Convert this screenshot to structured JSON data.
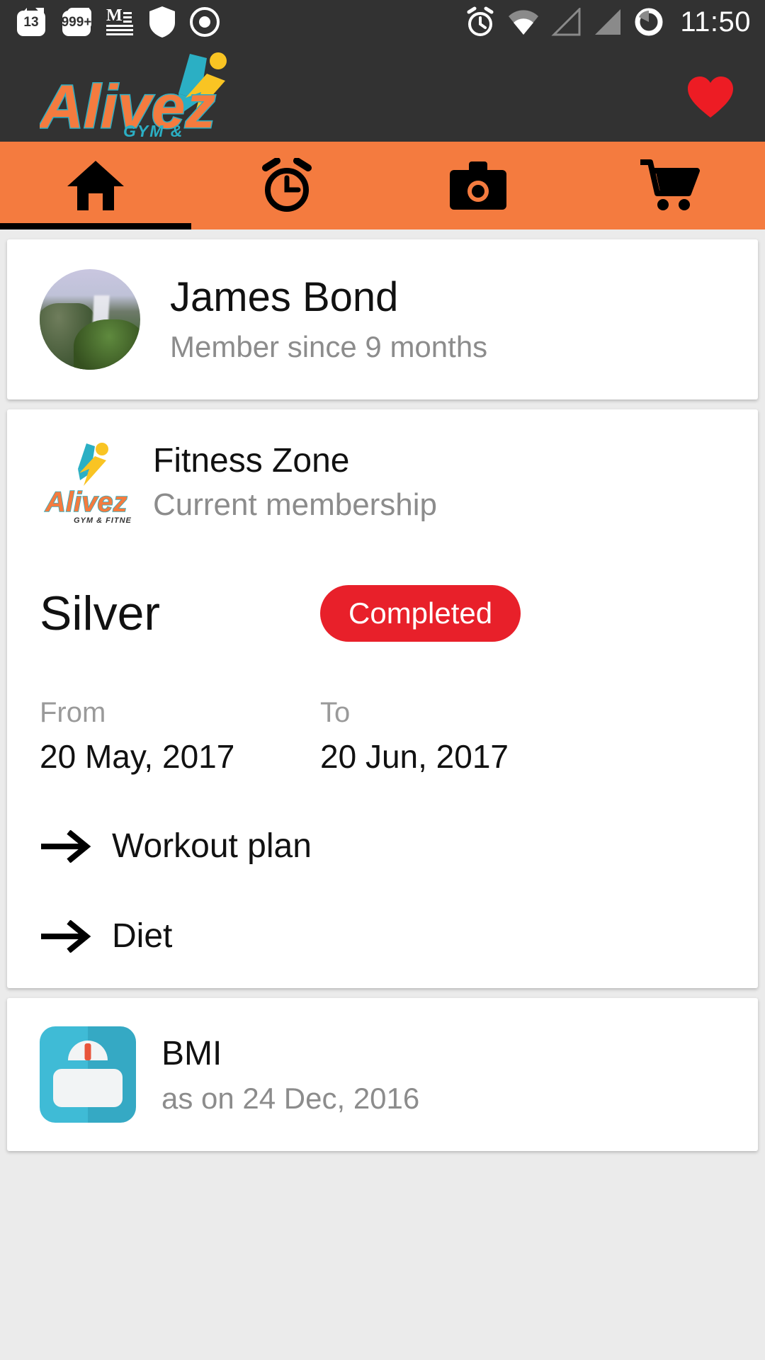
{
  "status_bar": {
    "time": "11:50",
    "notifications": [
      {
        "icon": "cat-notification-icon",
        "count": "13"
      },
      {
        "icon": "cat-notification-stacked-icon",
        "count": "999+"
      },
      {
        "icon": "medium-article-icon",
        "count": ""
      },
      {
        "icon": "shield-security-icon",
        "count": ""
      },
      {
        "icon": "record-dot-icon",
        "count": ""
      }
    ],
    "right_icons": [
      "alarm-icon",
      "wifi-icon",
      "signal-empty-icon",
      "signal-bars-icon",
      "battery-circle-icon"
    ]
  },
  "header": {
    "brand": "Alivez",
    "tagline": "GYM & FITNESS",
    "favorite_icon": "heart-icon",
    "colors": {
      "bar": "#323232",
      "brand_orange": "#F47B3F",
      "brand_cyan": "#2BAFC4",
      "heart_red": "#ED1C24"
    }
  },
  "tabs": {
    "active_index": 0,
    "items": [
      {
        "id": "home",
        "icon": "home-icon",
        "label": "Home"
      },
      {
        "id": "schedule",
        "icon": "alarm-clock-icon",
        "label": "Schedule"
      },
      {
        "id": "camera",
        "icon": "camera-icon",
        "label": "Camera"
      },
      {
        "id": "cart",
        "icon": "shopping-cart-icon",
        "label": "Cart"
      }
    ],
    "bar_color": "#F47B3F",
    "indicator_color": "#000000"
  },
  "profile": {
    "name": "James Bond",
    "member_since": "Member since 9 months",
    "avatar_icon": "waterfall-photo-avatar"
  },
  "membership": {
    "gym_name": "Fitness Zone",
    "caption": "Current membership",
    "logo_icon": "alivez-gym-logo",
    "plan": "Silver",
    "status": "Completed",
    "status_color": "#E8202A",
    "from_label": "From",
    "from_date": "20 May, 2017",
    "to_label": "To",
    "to_date": "20 Jun, 2017",
    "links": [
      {
        "label": "Workout plan",
        "icon": "arrow-right-icon"
      },
      {
        "label": "Diet",
        "icon": "arrow-right-icon"
      }
    ]
  },
  "bmi": {
    "title": "BMI",
    "subtitle": "as on 24 Dec, 2016",
    "icon": "weight-scale-icon",
    "icon_color": "#3FBBD6"
  }
}
